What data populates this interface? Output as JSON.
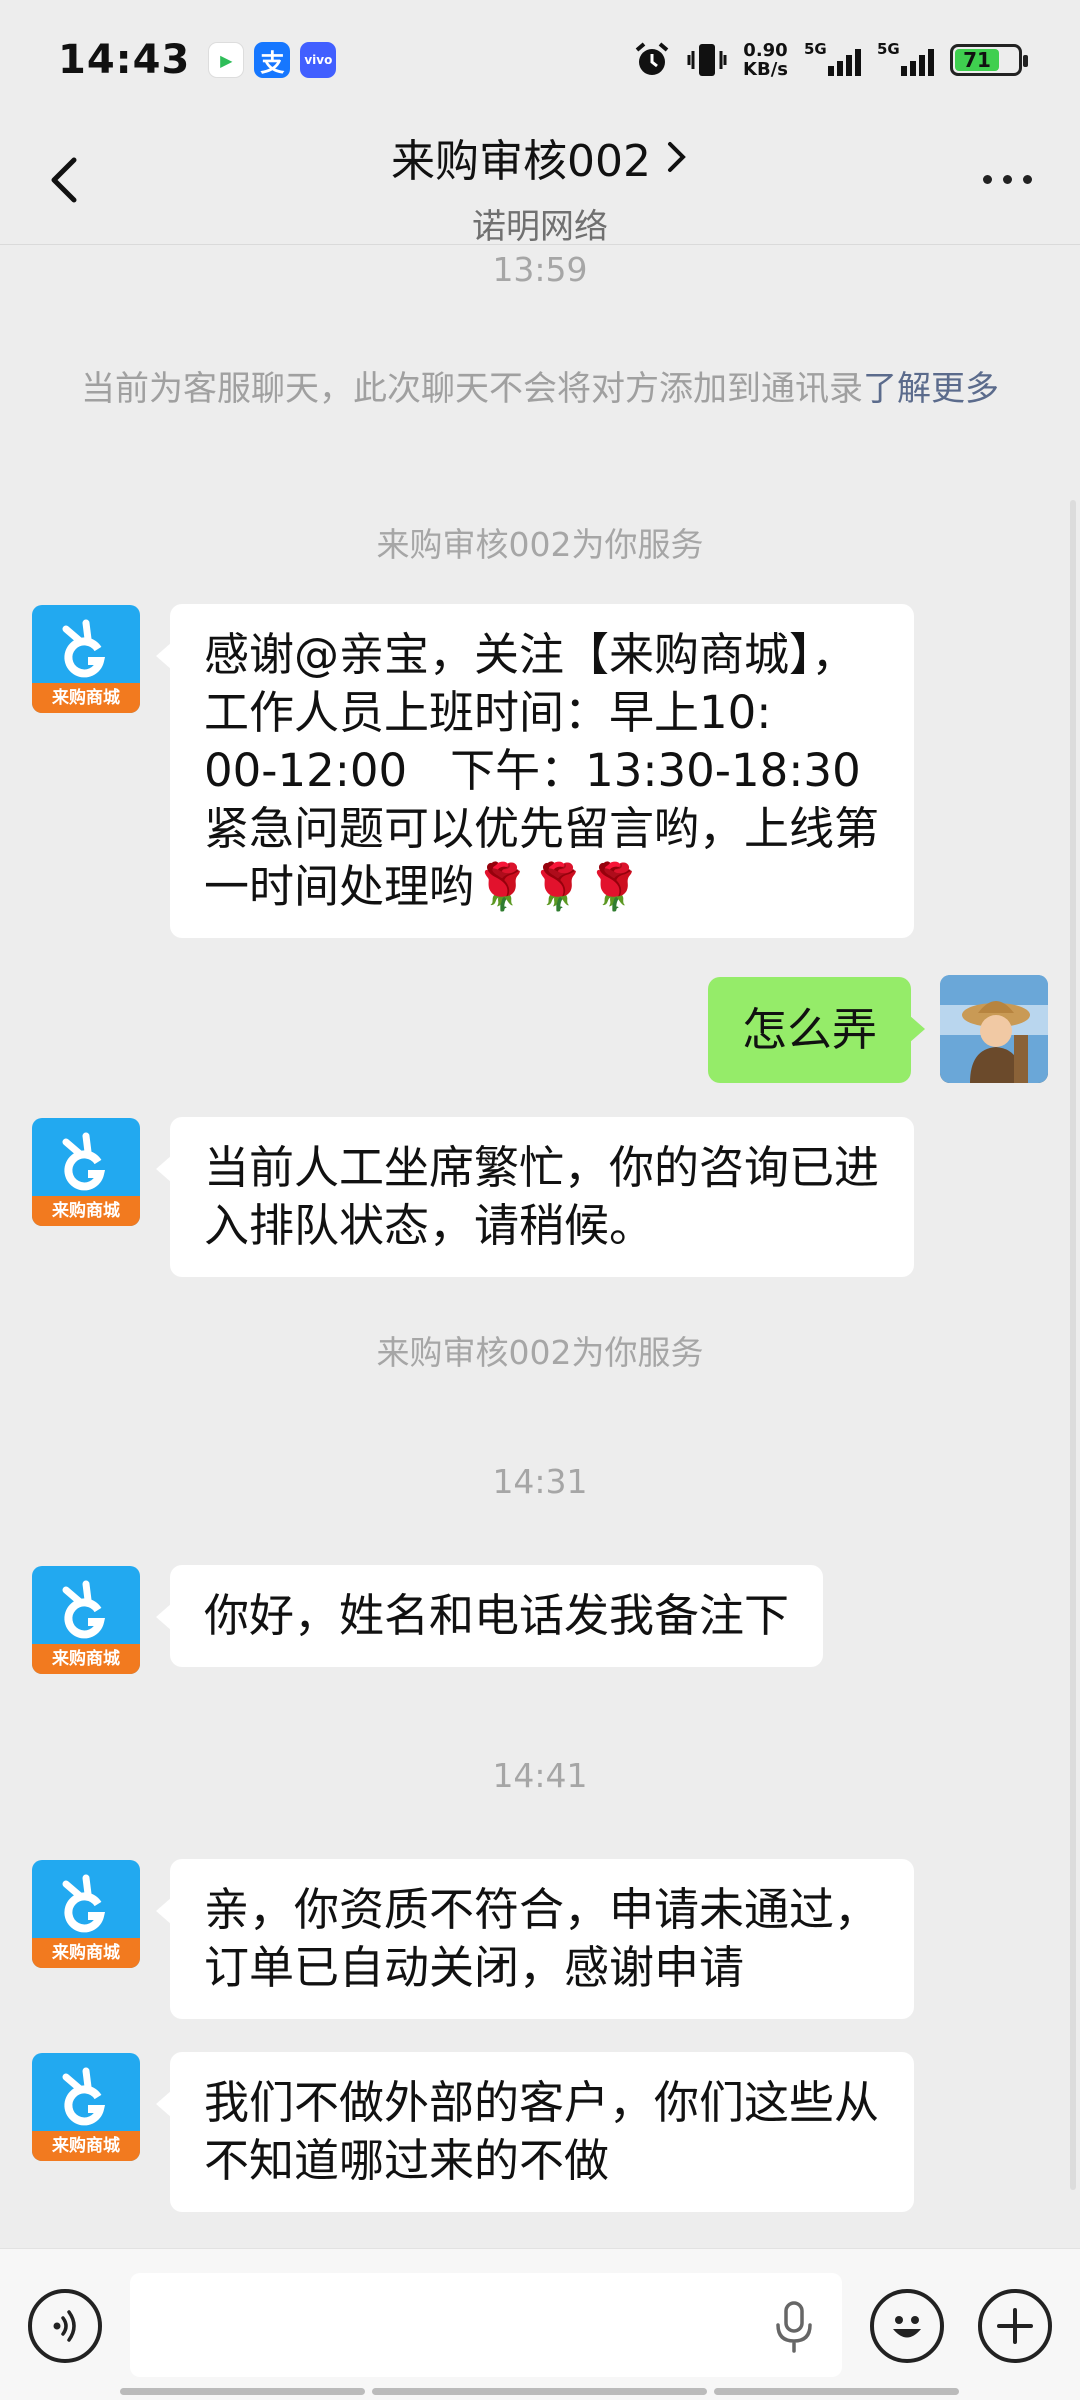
{
  "status_bar": {
    "time": "14:43",
    "apps": [
      {
        "icon": "video-app-icon",
        "color": "#2ebd59",
        "glyph": "▶"
      },
      {
        "icon": "alipay-icon",
        "color": "#1677ff",
        "glyph": "支"
      },
      {
        "icon": "vivo-icon",
        "color": "#415fff",
        "glyph": "vivo"
      }
    ],
    "net_speed_value": "0.90",
    "net_speed_unit": "KB/s",
    "signal_label_1": "5G",
    "signal_label_2": "5G",
    "battery_level": "71",
    "battery_fraction": 0.71
  },
  "header": {
    "title": "来购审核002",
    "subtitle": "诺明网络"
  },
  "chat": {
    "time_1": "13:59",
    "notice_text": "当前为客服聊天，此次聊天不会将对方添加到通讯录",
    "notice_link": "了解更多",
    "service_1": "来购审核002为你服务",
    "msg_1_lines": [
      "感谢@亲宝，关注【来购商城】，",
      "工作人员上班时间：早上10:",
      "00-12:00   下午：13:30-18:30",
      "紧急问题可以优先留言哟，上线第",
      "一时间处理哟"
    ],
    "msg_1_emoji": "🌹🌹🌹",
    "my_msg": "怎么弄",
    "msg_2_lines": [
      "当前人工坐席繁忙，你的咨询已进",
      "入排队状态，请稍候。"
    ],
    "service_2": "来购审核002为你服务",
    "time_2": "14:31",
    "msg_3": "你好，姓名和电话发我备注下",
    "time_3": "14:41",
    "msg_4_lines": [
      "亲，你资质不符合，申请未通过，",
      "订单已自动关闭，感谢申请"
    ],
    "msg_5_lines": [
      "我们不做外部的客户，你们这些从",
      "不知道哪过来的不做"
    ],
    "bot_avatar_label": "来购商城"
  },
  "input": {
    "value": "",
    "placeholder": ""
  }
}
